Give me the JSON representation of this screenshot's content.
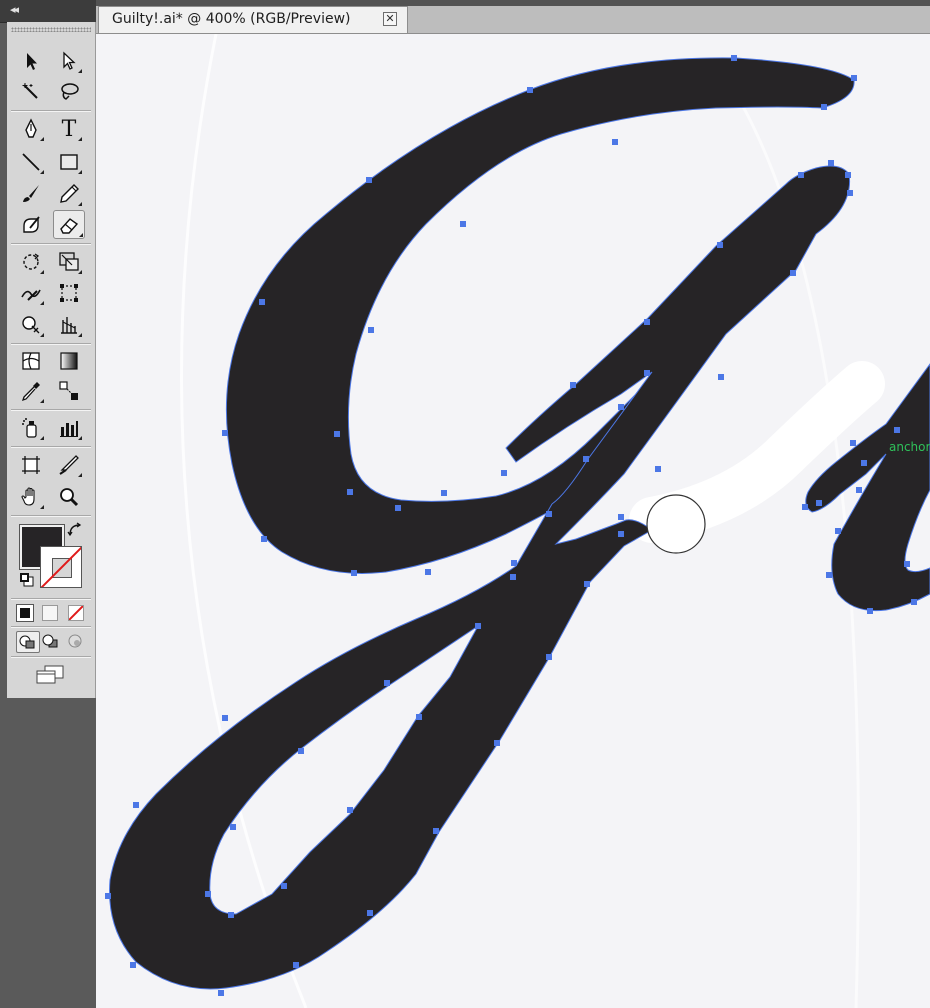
{
  "window": {
    "tab_title": "Guilty!.ai* @ 400% (RGB/Preview)",
    "tab_close_glyph": "✕"
  },
  "toolbox": {
    "collapse_glyph": "◂◂",
    "tools": [
      {
        "name": "selection-tool",
        "icon": "arrow-icon"
      },
      {
        "name": "direct-selection-tool",
        "icon": "hollow-arrow-icon"
      },
      {
        "name": "magic-wand-tool",
        "icon": "magic-wand-icon"
      },
      {
        "name": "lasso-tool",
        "icon": "lasso-icon"
      },
      {
        "name": "pen-tool",
        "icon": "pen-nib-icon"
      },
      {
        "name": "type-tool",
        "icon": "type-icon",
        "glyph": "T"
      },
      {
        "name": "line-segment-tool",
        "icon": "line-icon"
      },
      {
        "name": "rectangle-tool",
        "icon": "rectangle-icon"
      },
      {
        "name": "paintbrush-tool",
        "icon": "brush-icon"
      },
      {
        "name": "pencil-tool",
        "icon": "pencil-icon"
      },
      {
        "name": "blob-brush-tool",
        "icon": "blob-brush-icon"
      },
      {
        "name": "eraser-tool",
        "icon": "eraser-icon",
        "active": true
      },
      {
        "name": "rotate-tool",
        "icon": "rotate-icon"
      },
      {
        "name": "scale-tool",
        "icon": "scale-icon"
      },
      {
        "name": "warp-tool",
        "icon": "warp-icon"
      },
      {
        "name": "free-transform-tool",
        "icon": "free-transform-icon"
      },
      {
        "name": "symbol-sprayer-tool",
        "icon": "symbol-sprayer-icon"
      },
      {
        "name": "column-graph-tool",
        "icon": "graph-icon"
      },
      {
        "name": "mesh-tool",
        "icon": "mesh-icon"
      },
      {
        "name": "gradient-tool",
        "icon": "gradient-icon"
      },
      {
        "name": "eyedropper-tool",
        "icon": "eyedropper-icon"
      },
      {
        "name": "blend-tool",
        "icon": "blend-icon"
      },
      {
        "name": "symbol-sprayer-2-tool",
        "icon": "spray-can-icon"
      },
      {
        "name": "bar-graph-tool",
        "icon": "bar-graph-icon"
      },
      {
        "name": "artboard-tool",
        "icon": "artboard-icon"
      },
      {
        "name": "slice-tool",
        "icon": "knife-icon"
      },
      {
        "name": "hand-tool",
        "icon": "hand-icon"
      },
      {
        "name": "zoom-tool",
        "icon": "magnifier-icon"
      }
    ],
    "fill_color": "#262426",
    "stroke_color": "none"
  },
  "canvas": {
    "artwork_color": "#262426",
    "anchor_color": "#4c77e6",
    "smart_guide_label": "anchor",
    "smart_guide_color": "#2fc05a",
    "eraser_path_color": "#ffffff"
  }
}
